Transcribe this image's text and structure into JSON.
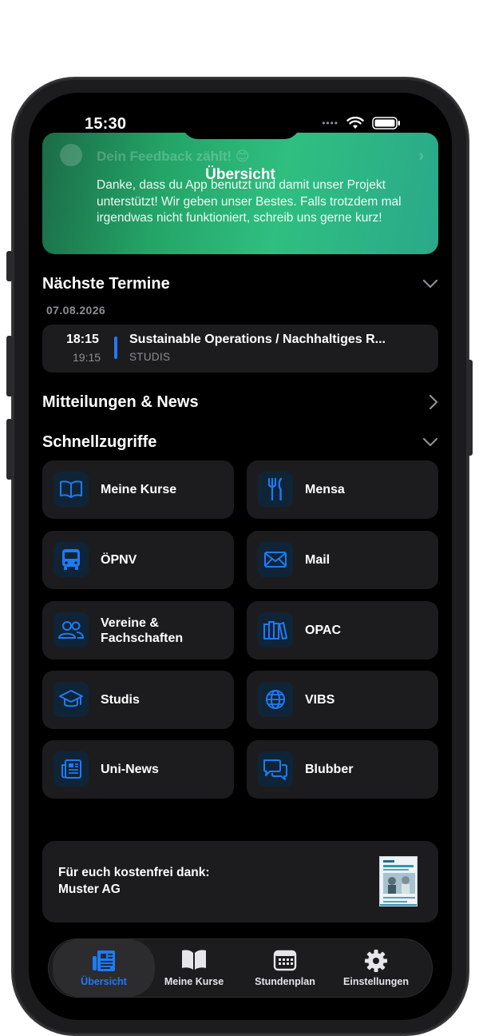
{
  "status_bar": {
    "time": "15:30",
    "icons": [
      "signal-dots",
      "wifi-icon",
      "battery-icon"
    ]
  },
  "banner": {
    "title": "Übersicht",
    "ghost_title": "Dein Feedback zählt! 😊",
    "text": "Danke, dass du A⁠pp benutzt und damit unser Projekt unterstützt! Wir geben unser Bestes. Falls trotzdem mal irgendwas nicht funktioniert, schreib uns gerne kurz!",
    "color": "#2fbf80"
  },
  "appointments": {
    "title": "Nächste Termine",
    "date": "07.08.2026",
    "events": [
      {
        "start": "18:15",
        "end": "19:15",
        "name": "Sustainable Operations / Nachhaltiges R...",
        "source": "STUDIS"
      }
    ]
  },
  "news": {
    "title": "Mitteilungen & News"
  },
  "quick_access": {
    "title": "Schnellzugriffe",
    "items": [
      {
        "label": "Meine Kurse",
        "icon": "book-icon"
      },
      {
        "label": "Mensa",
        "icon": "fork-knife-icon"
      },
      {
        "label": "ÖPNV",
        "icon": "bus-icon"
      },
      {
        "label": "Mail",
        "icon": "envelope-icon"
      },
      {
        "label": "Vereine & Fachschaften",
        "icon": "people-icon"
      },
      {
        "label": "OPAC",
        "icon": "books-icon"
      },
      {
        "label": "Studis",
        "icon": "graduation-cap-icon"
      },
      {
        "label": "VIBS",
        "icon": "globe-icon"
      },
      {
        "label": "Uni-News",
        "icon": "newspaper-icon"
      },
      {
        "label": "Blubber",
        "icon": "chat-bubbles-icon"
      }
    ]
  },
  "sponsor": {
    "line1": "Für euch kostenfrei dank:",
    "line2": "Muster AG"
  },
  "tab_bar": {
    "active": "Übersicht",
    "items": [
      {
        "label": "Übersicht",
        "icon": "newspaper-icon"
      },
      {
        "label": "Meine Kurse",
        "icon": "book-icon"
      },
      {
        "label": "Stundenplan",
        "icon": "calendar-icon"
      },
      {
        "label": "Einstellungen",
        "icon": "gear-icon"
      }
    ]
  },
  "colors": {
    "accent": "#1e7bf2",
    "background": "#000000",
    "card": "#1c1c1e",
    "secondary_text": "#8e8e93"
  }
}
